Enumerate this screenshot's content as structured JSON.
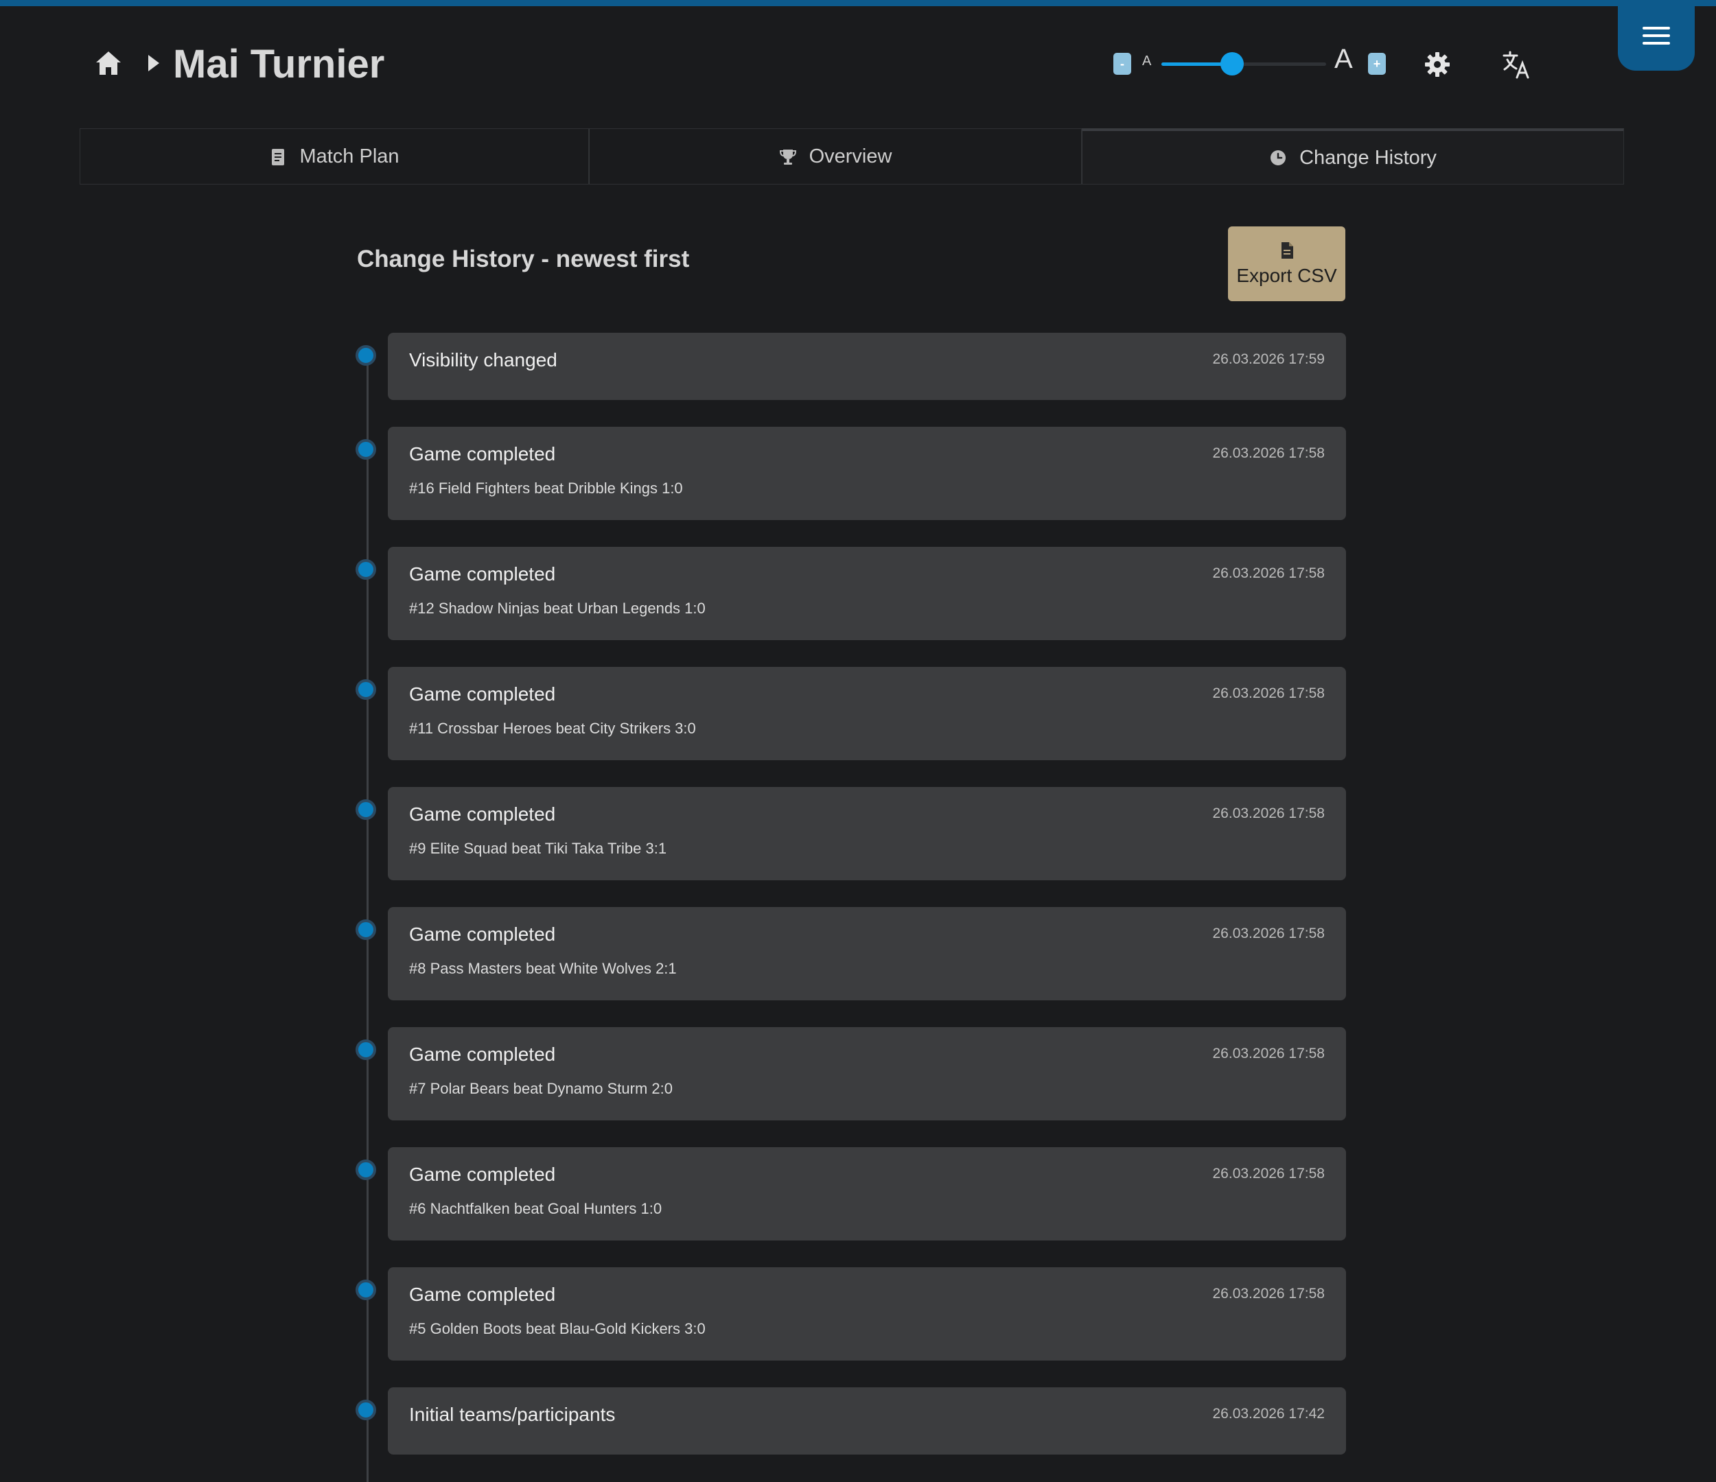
{
  "header": {
    "title": "Mai Turnier",
    "font_size_small_label": "A",
    "font_size_large_label": "A",
    "font_size_minus_label": "-",
    "font_size_plus_label": "+",
    "font_size_level": 0.43,
    "icons": [
      "home-icon",
      "chevron-right-icon",
      "gear-icon",
      "translate-icon",
      "hamburger-menu-icon"
    ]
  },
  "tabs": [
    {
      "label": "Match Plan",
      "icon": "document-icon"
    },
    {
      "label": "Overview",
      "icon": "trophy-icon"
    },
    {
      "label": "Change History",
      "icon": "clock-icon",
      "active": true
    }
  ],
  "history": {
    "title": "Change History - newest first",
    "export_label": "Export CSV",
    "entries": [
      {
        "title": "Visibility changed",
        "detail": "",
        "time": "26.03.2026 17:59"
      },
      {
        "title": "Game completed",
        "detail": "#16 Field Fighters beat Dribble Kings 1:0",
        "time": "26.03.2026 17:58"
      },
      {
        "title": "Game completed",
        "detail": "#12 Shadow Ninjas beat Urban Legends 1:0",
        "time": "26.03.2026 17:58"
      },
      {
        "title": "Game completed",
        "detail": "#11 Crossbar Heroes beat City Strikers 3:0",
        "time": "26.03.2026 17:58"
      },
      {
        "title": "Game completed",
        "detail": "#9 Elite Squad beat Tiki Taka Tribe 3:1",
        "time": "26.03.2026 17:58"
      },
      {
        "title": "Game completed",
        "detail": "#8 Pass Masters beat White Wolves 2:1",
        "time": "26.03.2026 17:58"
      },
      {
        "title": "Game completed",
        "detail": "#7 Polar Bears beat Dynamo Sturm 2:0",
        "time": "26.03.2026 17:58"
      },
      {
        "title": "Game completed",
        "detail": "#6 Nachtfalken beat Goal Hunters 1:0",
        "time": "26.03.2026 17:58"
      },
      {
        "title": "Game completed",
        "detail": "#5 Golden Boots beat Blau-Gold Kickers 3:0",
        "time": "26.03.2026 17:58"
      },
      {
        "title": "Initial teams/participants",
        "detail": "",
        "time": "26.03.2026 17:42"
      }
    ]
  },
  "colors": {
    "accent": "#12a0e8",
    "topbar": "#0d5a8c",
    "background": "#1a1b1d",
    "card": "#3c3d3f",
    "export_button": "#b8a682"
  }
}
